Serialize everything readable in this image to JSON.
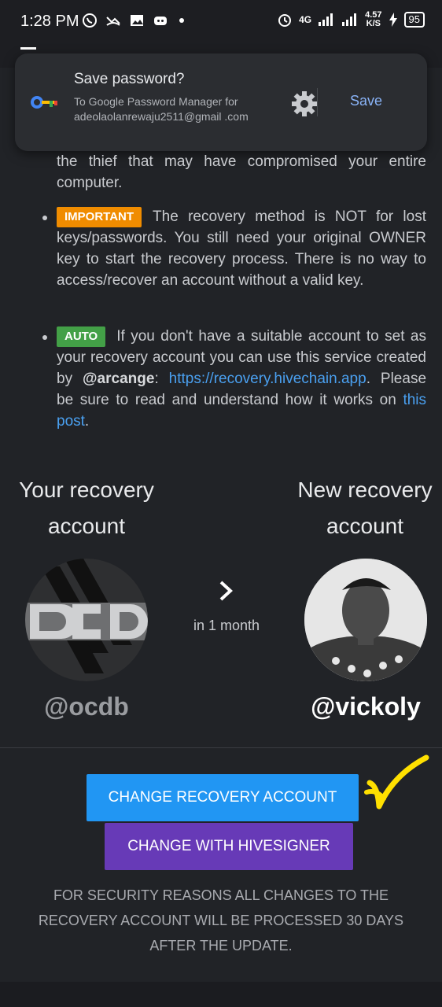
{
  "status_bar": {
    "time": "1:28 PM",
    "network": "4G",
    "speed_value": "4.57",
    "speed_unit": "K/S",
    "battery": "95"
  },
  "popup": {
    "title": "Save password?",
    "subtitle": "To Google Password Manager for adeolaolanrewaju2511@gmail .com",
    "save_label": "Save"
  },
  "content": {
    "intro_text": "the thief that may have compromised your entire computer.",
    "important_badge": "IMPORTANT",
    "important_text": "The recovery method is NOT for lost keys/passwords. You still need your original OWNER key to start the recovery process. There is no way to access/recover an account without a valid key.",
    "auto_badge": "AUTO",
    "auto_text_1": "If you don't have a suitable account to set as your recovery account you can use this service created by",
    "auto_handle": "@arcange",
    "auto_colon": ":",
    "auto_link": "https://recovery.hivechain.app",
    "auto_text_2": ". Please be sure to read and understand how it works on",
    "auto_post_link": "this post",
    "auto_period": "."
  },
  "recovery": {
    "current_label": "Your recovery account",
    "new_label": "New recovery account",
    "timing": "in 1 month",
    "current_handle": "@ocdb",
    "new_handle": "@vickoly",
    "colors": {
      "current_handle": "#9a9ca0",
      "new_handle": "#ffffff"
    }
  },
  "actions": {
    "change_button": "CHANGE RECOVERY ACCOUNT",
    "hivesigner_button": "CHANGE WITH HIVESIGNER",
    "note": "FOR SECURITY REASONS ALL CHANGES TO THE RECOVERY ACCOUNT WILL BE PROCESSED 30 DAYS AFTER THE UPDATE."
  },
  "icons": {
    "key": "key-icon",
    "gear": "gear-icon",
    "chevron": "chevron-right-icon",
    "checkmark": "checkmark-annotation"
  },
  "colors": {
    "background": "#212327",
    "primary_button": "#2196f3",
    "secondary_button": "#673ab7",
    "link": "#4aa0f0",
    "badge_important": "#f08c00",
    "badge_auto": "#43a047",
    "annotation": "#ffe000"
  }
}
